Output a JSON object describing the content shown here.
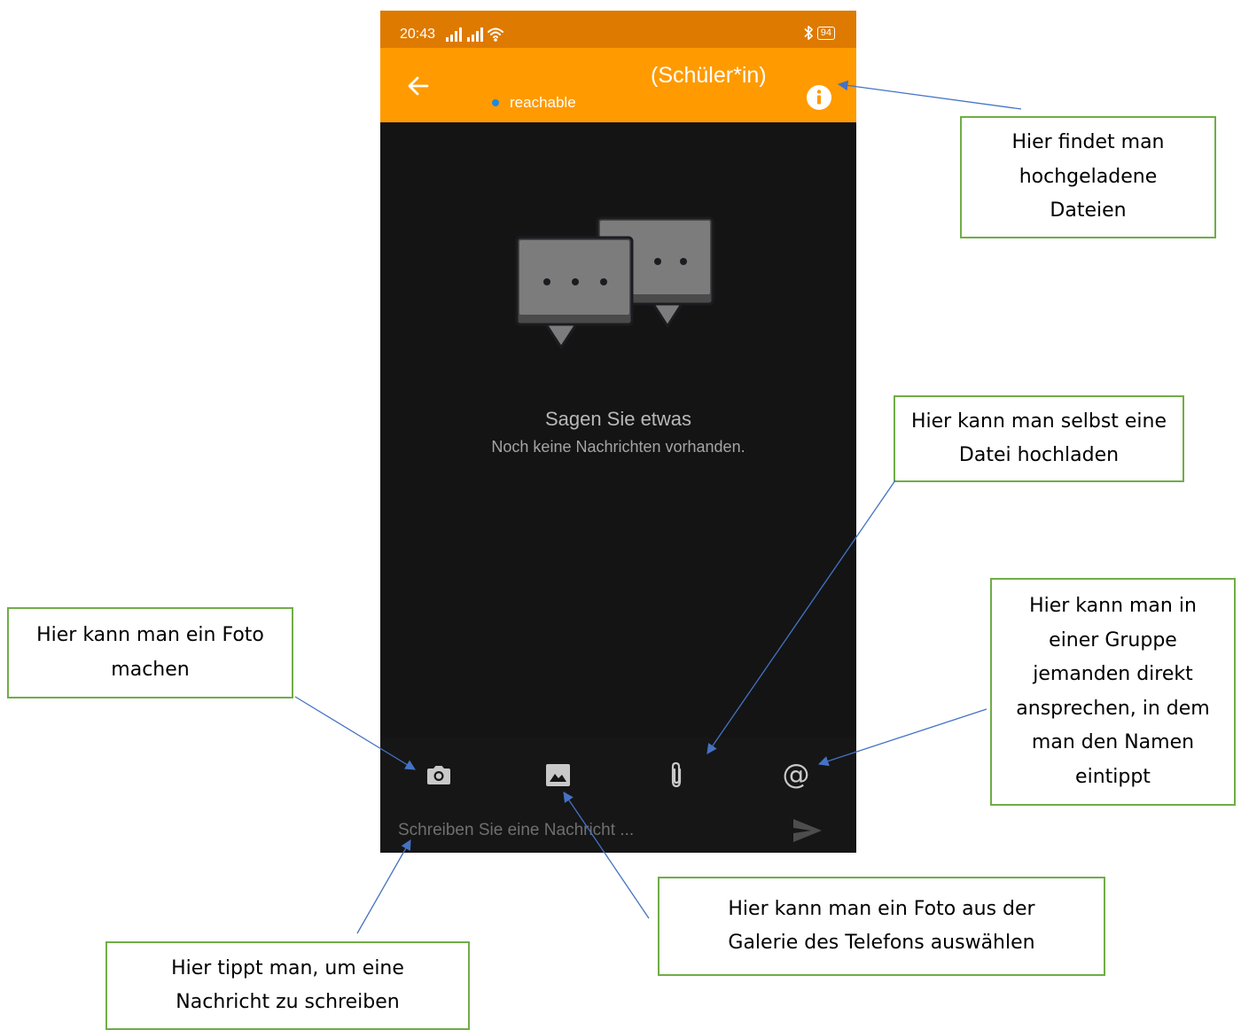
{
  "status_bar": {
    "time": "20:43",
    "battery": "94"
  },
  "app_bar": {
    "title": "(Schüler*in)",
    "presence": "reachable"
  },
  "empty_state": {
    "title": "Sagen Sie etwas",
    "subtitle": "Noch keine Nachrichten vorhanden."
  },
  "composer": {
    "mention_symbol": "@",
    "placeholder": "Schreiben Sie eine Nachricht ..."
  },
  "icons": {
    "back": "arrow-left-icon",
    "info": "info-icon",
    "camera": "camera-icon",
    "gallery": "image-icon",
    "attach": "paperclip-icon",
    "mention": "at-sign-icon",
    "send": "send-icon"
  },
  "annotations": {
    "info": "Hier findet man hochgeladene Dateien",
    "upload": "Hier kann man selbst eine Datei hochladen",
    "camera": "Hier kann man ein Foto machen",
    "mention": "Hier kann man in einer Gruppe jemanden direkt ansprechen, in dem man den Namen eintippt",
    "gallery": "Hier kann man ein Foto aus der Galerie des Telefons auswählen",
    "input": "Hier tippt man, um eine Nachricht zu schreiben"
  },
  "colors": {
    "status_bar": "#de7a00",
    "app_bar": "#ff9a00",
    "chat_background": "#141414",
    "presence_dot": "#1e88e5",
    "callout_border": "#70ad47",
    "arrow": "#4472c4"
  }
}
